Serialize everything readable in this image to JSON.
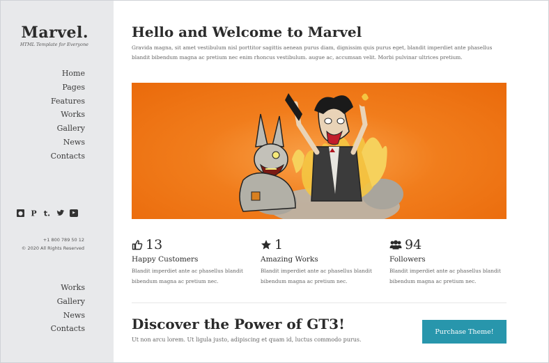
{
  "brand": {
    "title": "Marvel.",
    "subtitle": "HTML Template for Everyone"
  },
  "sidebar": {
    "nav": [
      "Home",
      "Pages",
      "Features",
      "Works",
      "Gallery",
      "News",
      "Contacts"
    ],
    "social_icons": [
      "flickr-icon",
      "pinterest-icon",
      "tumblr-icon",
      "twitter-icon",
      "youtube-icon"
    ],
    "phone": "+1 800 789 50 12",
    "copyright": "© 2020 All Rights Reserved",
    "bottom_nav": [
      "Works",
      "Gallery",
      "News",
      "Contacts"
    ]
  },
  "welcome": {
    "title": "Hello and Welcome to Marvel",
    "text": "Gravida magna, sit amet vestibulum nisl porttitor sagittis aenean purus diam, dignissim quis purus eget, blandit imperdiet ante phasellus blandit bibendum magna ac pretium nec enim rhoncus vestibulum. augue ac, accumsan velit. Morbi pulvinar ultrices pretium."
  },
  "hero": {
    "background_color": "#ef7414",
    "illustration": "cartoon-zombie-rabbit-and-flaming-punk"
  },
  "stats": [
    {
      "icon": "thumbs-up-icon",
      "number": "13",
      "title": "Happy Customers",
      "text": "Blandit imperdiet ante ac phasellus blandit bibendum magna ac pretium nec."
    },
    {
      "icon": "star-icon",
      "number": "1",
      "title": "Amazing Works",
      "text": "Blandit imperdiet ante ac phasellus blandit bibendum magna ac pretium nec."
    },
    {
      "icon": "users-icon",
      "number": "94",
      "title": "Followers",
      "text": "Blandit imperdiet ante ac phasellus blandit bibendum magna ac pretium nec."
    }
  ],
  "cta": {
    "title": "Discover the Power of GT3!",
    "text": "Ut non arcu lorem. Ut ligula justo, adipiscing et quam id, luctus commodo purus.",
    "button": "Purchase Theme!"
  },
  "colors": {
    "sidebar_bg": "#e8e9eb",
    "accent": "#2896ac",
    "hero_orange": "#ef7414",
    "text_dark": "#2b2b2b"
  }
}
